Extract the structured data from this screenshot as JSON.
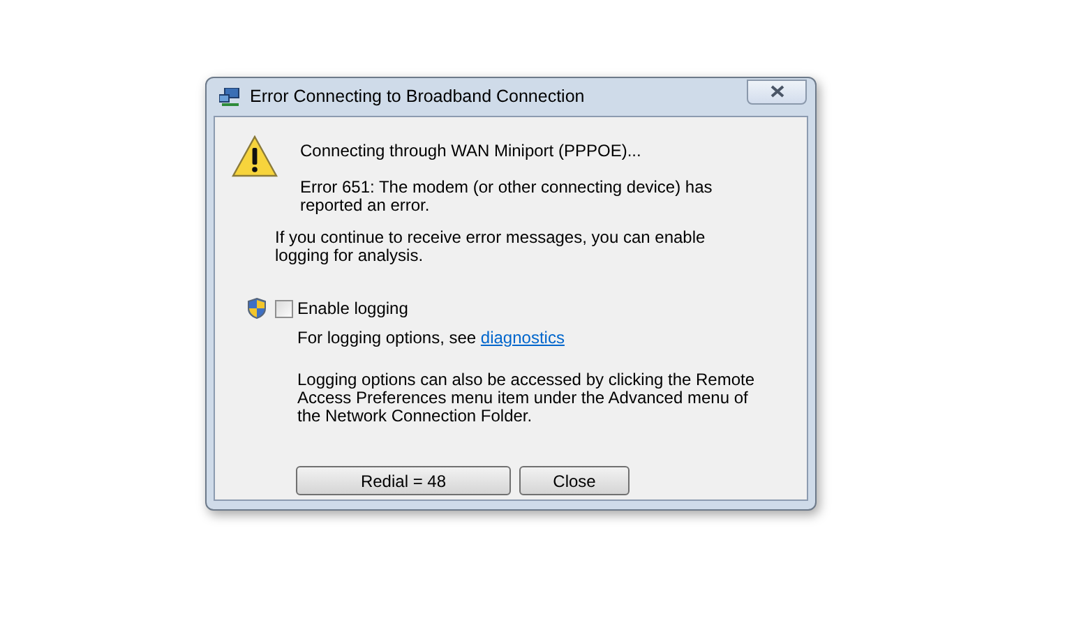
{
  "window": {
    "title": "Error Connecting to Broadband Connection"
  },
  "message": {
    "connecting": "Connecting through WAN Miniport (PPPOE)...",
    "error": "Error 651: The modem (or other connecting device) has reported an error."
  },
  "hint": "If you continue to receive error messages, you can enable logging for analysis.",
  "logging": {
    "label": "Enable logging",
    "checked": false,
    "options_text": "For logging options, see ",
    "link": "diagnostics",
    "note": "Logging options can also be accessed by clicking the Remote Access Preferences menu item under the Advanced menu of the Network Connection Folder."
  },
  "buttons": [
    {
      "label": "Redial = 48",
      "kind": "wide"
    },
    {
      "label": "Close",
      "kind": "normal"
    }
  ]
}
